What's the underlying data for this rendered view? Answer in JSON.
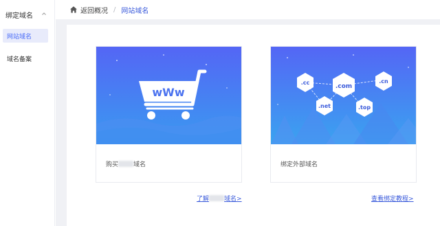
{
  "sidebar": {
    "group_label": "绑定域名",
    "items": [
      {
        "label": "网站域名"
      },
      {
        "label": "域名备案"
      }
    ]
  },
  "breadcrumb": {
    "back_label": "返回概况",
    "separator": "/",
    "current": "网站域名"
  },
  "cards": [
    {
      "caption_prefix": "购买",
      "caption_suffix": "域名",
      "banner_text": "wWw"
    },
    {
      "caption": "绑定外部域名",
      "tags": [
        ".cc",
        ".com",
        ".cn",
        ".net",
        ".top"
      ]
    }
  ],
  "links": {
    "learn_prefix": "了解",
    "learn_suffix": "域名>",
    "tutorial": "查看绑定教程>"
  },
  "colors": {
    "accent": "#3b5bdb",
    "banner_top": "#5466f5",
    "banner_bottom": "#3aa3f0"
  }
}
